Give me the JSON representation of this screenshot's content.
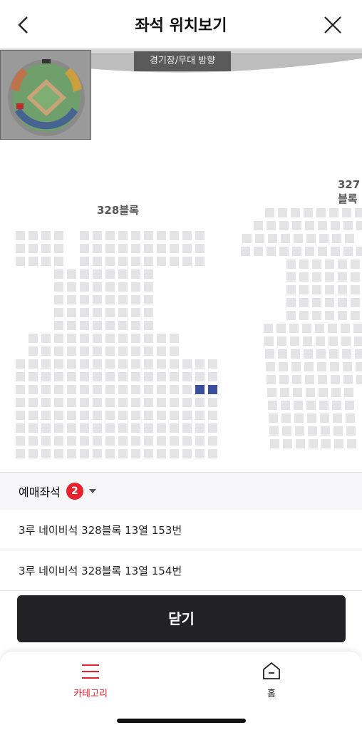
{
  "header": {
    "title": "좌석 위치보기"
  },
  "seatmap": {
    "stage_label": "경기장/무대 방향",
    "blocks": [
      {
        "label": "328블록"
      },
      {
        "label": "327블록"
      }
    ],
    "selected_color": "#3a4f9e",
    "seat_color": "#e4e4e6"
  },
  "tickets": {
    "label": "예매좌석",
    "count": "2",
    "items": [
      "3루 네이비석 328블록 13열 153번",
      "3루 네이비석 328블록 13열 154번"
    ]
  },
  "close_button": "닫기",
  "nav": {
    "category": "카테고리",
    "home": "홈",
    "active_color": "#e8222c"
  }
}
